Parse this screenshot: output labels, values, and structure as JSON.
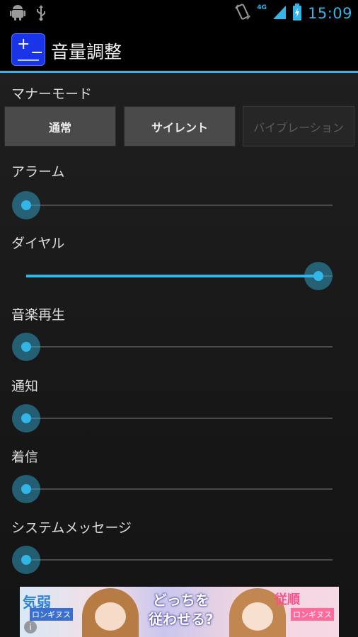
{
  "status_bar": {
    "time": "15:09",
    "network": "4G",
    "icons": [
      "android-icon",
      "usb-icon",
      "rotation-icon",
      "signal-icon",
      "battery-icon"
    ]
  },
  "app": {
    "title": "音量調整",
    "icon": "volume-control-app-icon"
  },
  "manner_mode": {
    "label": "マナーモード",
    "buttons": [
      {
        "label": "通常",
        "enabled": true
      },
      {
        "label": "サイレント",
        "enabled": true
      },
      {
        "label": "バイブレーション",
        "enabled": false
      }
    ]
  },
  "volumes": [
    {
      "label": "アラーム",
      "level": 0.0
    },
    {
      "label": "ダイヤル",
      "level": 1.0
    },
    {
      "label": "音楽再生",
      "level": 0.0
    },
    {
      "label": "通知",
      "level": 0.0
    },
    {
      "label": "着信",
      "level": 0.0
    },
    {
      "label": "システムメッセージ",
      "level": 0.0
    }
  ],
  "ad": {
    "left_text": "気弱",
    "left_sub": "ロンギヌス",
    "center_text_1": "どっちを",
    "center_text_2": "従わせる?",
    "right_text": "従順",
    "right_sub": "ロンギヌス",
    "info": "i"
  },
  "colors": {
    "accent": "#33b5e5",
    "background": "#1c1c1c",
    "button": "#4a4a4a",
    "app_icon": "#1a35e8"
  }
}
